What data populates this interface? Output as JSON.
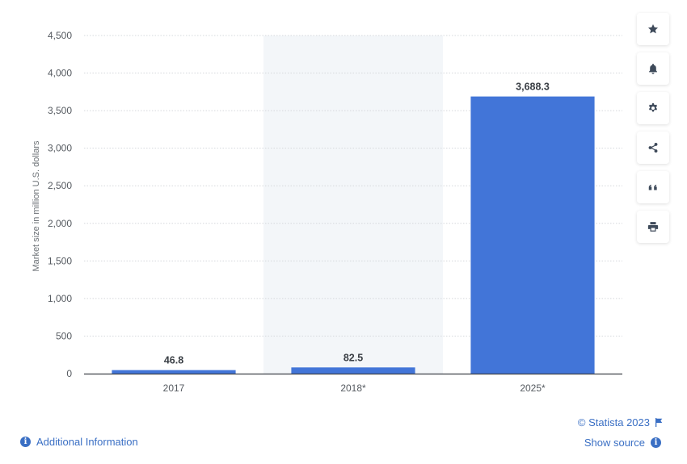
{
  "chart_data": {
    "type": "bar",
    "categories": [
      "2017",
      "2018*",
      "2025*"
    ],
    "values": [
      46.8,
      82.5,
      3688.3
    ],
    "value_labels": [
      "46.8",
      "82.5",
      "3,688.3"
    ],
    "title": "",
    "xlabel": "",
    "ylabel": "Market size in million U.S. dollars",
    "ylim": [
      0,
      4500
    ],
    "yticks": [
      0,
      500,
      1000,
      1500,
      2000,
      2500,
      3000,
      3500,
      4000,
      4500
    ],
    "ytick_labels": [
      "0",
      "500",
      "1,000",
      "1,500",
      "2,000",
      "2,500",
      "3,000",
      "3,500",
      "4,000",
      "4,500"
    ],
    "grid": true,
    "highlighted_category": "2018*",
    "bar_color": "#4275d8",
    "highlight_color": "#f3f6f9"
  },
  "toolbar": {
    "buttons": [
      {
        "name": "favorite-button",
        "icon": "star-icon"
      },
      {
        "name": "notification-button",
        "icon": "bell-icon"
      },
      {
        "name": "settings-button",
        "icon": "gear-icon"
      },
      {
        "name": "share-button",
        "icon": "share-icon"
      },
      {
        "name": "cite-button",
        "icon": "quote-icon"
      },
      {
        "name": "print-button",
        "icon": "printer-icon"
      }
    ]
  },
  "footer": {
    "additional_info": "Additional Information",
    "copyright": "© Statista 2023",
    "show_source": "Show source",
    "link_color": "#3a6fc4"
  }
}
